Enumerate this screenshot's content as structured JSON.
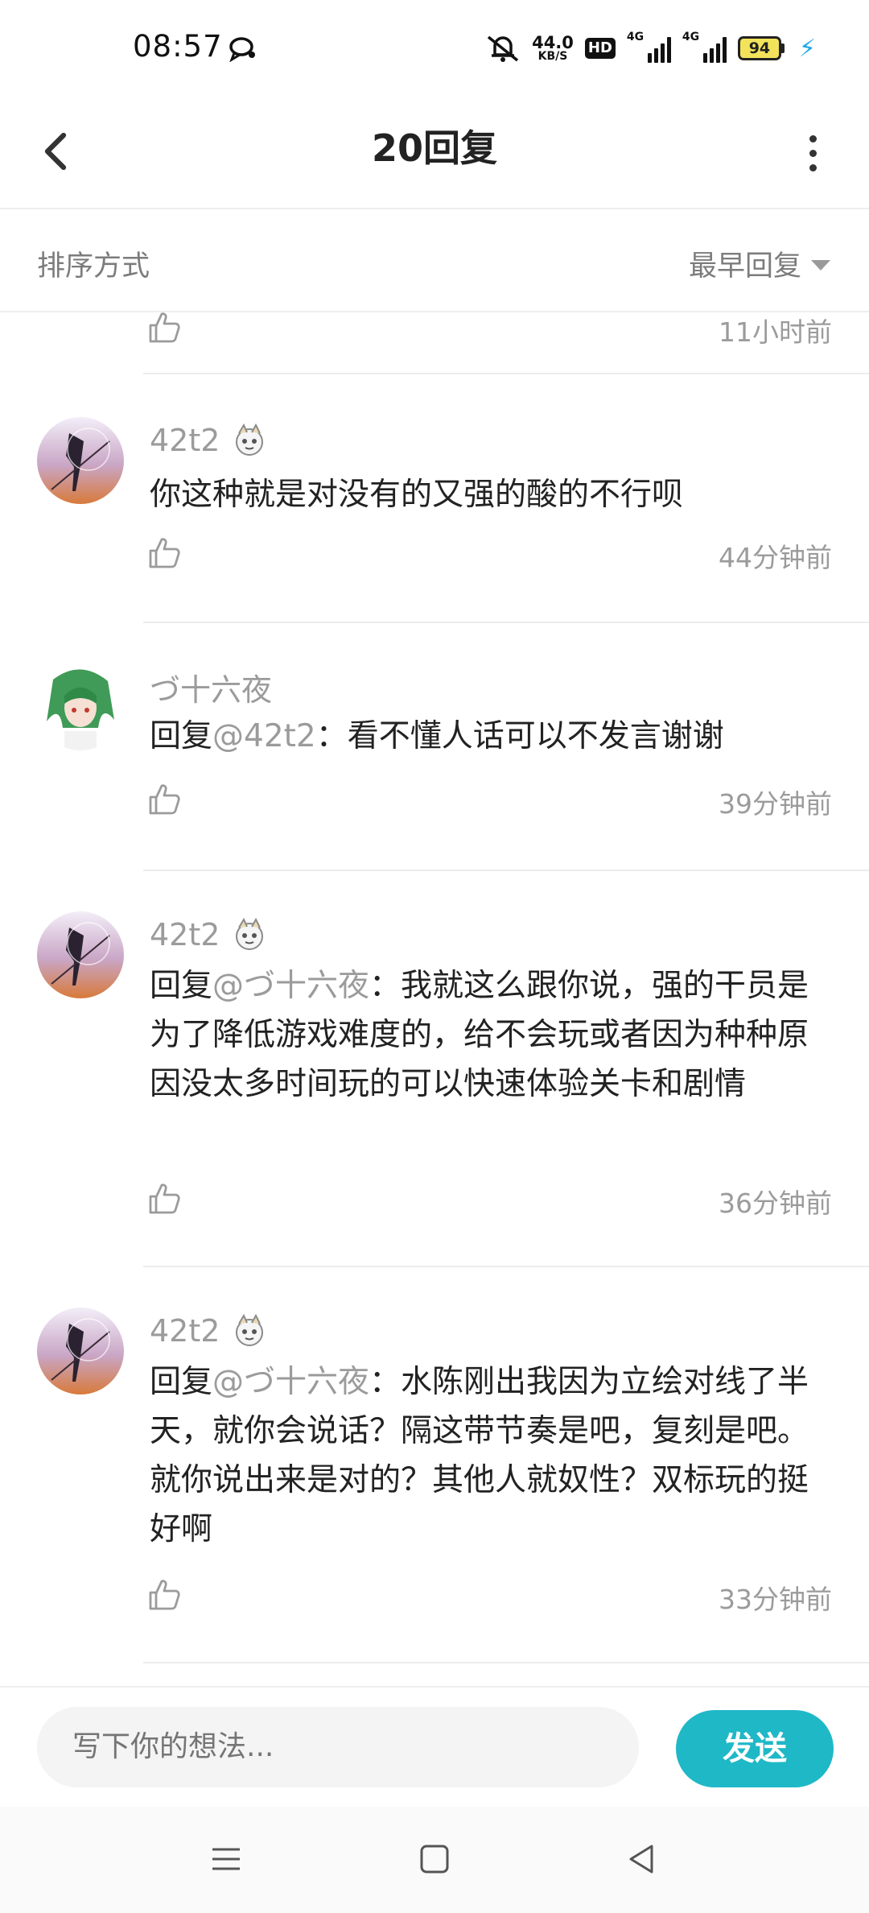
{
  "status_bar": {
    "time": "08:57",
    "speed_value": "44.0",
    "speed_unit": "KB/S",
    "hd_badge": "HD",
    "signal1_label": "4G",
    "signal2_label": "4G",
    "battery": "94",
    "icons": [
      "chat-notify-icon",
      "mute-bell-icon",
      "signal-icon",
      "battery-icon",
      "charging-icon"
    ]
  },
  "header": {
    "title": "20回复",
    "back_icon": "chevron-left-icon",
    "more_icon": "more-vertical-icon"
  },
  "sort": {
    "label": "排序方式",
    "selected": "最早回复"
  },
  "partial_row": {
    "time": "11小时前"
  },
  "comments": [
    {
      "username": "42t2",
      "content": "你这种就是对没有的又强的酸的不行呗",
      "mention": "",
      "time": "44分钟前"
    },
    {
      "username": "づ十六夜",
      "reply_prefix": "回复",
      "mention": "@42t2",
      "content": "：看不懂人话可以不发言谢谢",
      "time": "39分钟前"
    },
    {
      "username": "42t2",
      "reply_prefix": "回复",
      "mention": "@づ十六夜",
      "content": "：我就这么跟你说，强的干员是为了降低游戏难度的，给不会玩或者因为种种原因没太多时间玩的可以快速体验关卡和剧情",
      "time": "36分钟前"
    },
    {
      "username": "42t2",
      "reply_prefix": "回复",
      "mention": "@づ十六夜",
      "content": "：水陈刚出我因为立绘对线了半天，就你会说话？隔这带节奏是吧，复刻是吧。就你说出来是对的？其他人就奴性？双标玩的挺好啊",
      "time": "33分钟前"
    }
  ],
  "reply_bar": {
    "placeholder": "写下你的想法...",
    "send_label": "发送"
  },
  "colors": {
    "accent": "#1fb8c7",
    "muted_text": "#9b9b9b",
    "divider": "#ececec"
  }
}
